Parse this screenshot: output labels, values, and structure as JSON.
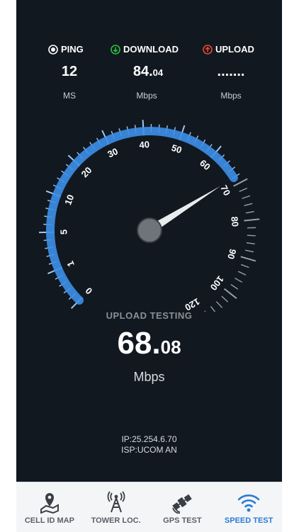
{
  "stats": {
    "ping": {
      "label": "PING",
      "value": "12",
      "unit": "MS",
      "icon": "ping-icon"
    },
    "download": {
      "label": "DOWNLOAD",
      "value_int": "84.",
      "value_dec": "04",
      "unit": "Mbps",
      "icon": "download-arrow-icon",
      "color": "#2bbf3a"
    },
    "upload": {
      "label": "UPLOAD",
      "value": ".......",
      "unit": "Mbps",
      "icon": "upload-arrow-icon",
      "color": "#e8472b"
    }
  },
  "gauge": {
    "tick_labels": [
      "0",
      "1",
      "5",
      "10",
      "20",
      "30",
      "40",
      "50",
      "60",
      "70",
      "80",
      "90",
      "100",
      "120"
    ],
    "current_value": 68.08,
    "accent": "#3d8fe8"
  },
  "status": {
    "label": "UPLOAD TESTING",
    "speed_int": "68.",
    "speed_dec": "08",
    "unit": "Mbps"
  },
  "network": {
    "ip": "IP:25.254.6.70",
    "isp": "ISP:UCOM AN"
  },
  "tabs": [
    {
      "label": "CELL ID MAP",
      "icon": "map-pin-icon",
      "active": false
    },
    {
      "label": "TOWER LOC.",
      "icon": "cell-tower-icon",
      "active": false
    },
    {
      "label": "GPS TEST",
      "icon": "satellite-icon",
      "active": false
    },
    {
      "label": "SPEED TEST",
      "icon": "wifi-icon",
      "active": true
    }
  ]
}
